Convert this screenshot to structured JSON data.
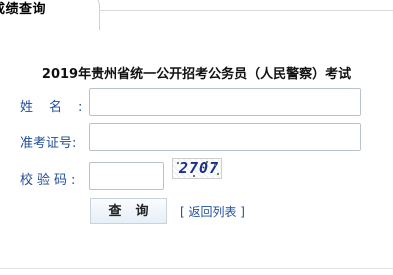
{
  "tab": {
    "label": "成绩查询"
  },
  "form": {
    "title": "2019年贵州省统一公开招考公务员（人民警察）考试",
    "name_label": "姓名:",
    "id_label": "准考证号:",
    "code_label": "校验码:",
    "name_value": "",
    "id_value": "",
    "code_value": "",
    "captcha_text": "2707",
    "query_button": "查询",
    "back_link": "[ 返回列表 ]"
  },
  "colors": {
    "label_blue": "#1f4e9c",
    "captcha_blue": "#1a2e8c"
  }
}
